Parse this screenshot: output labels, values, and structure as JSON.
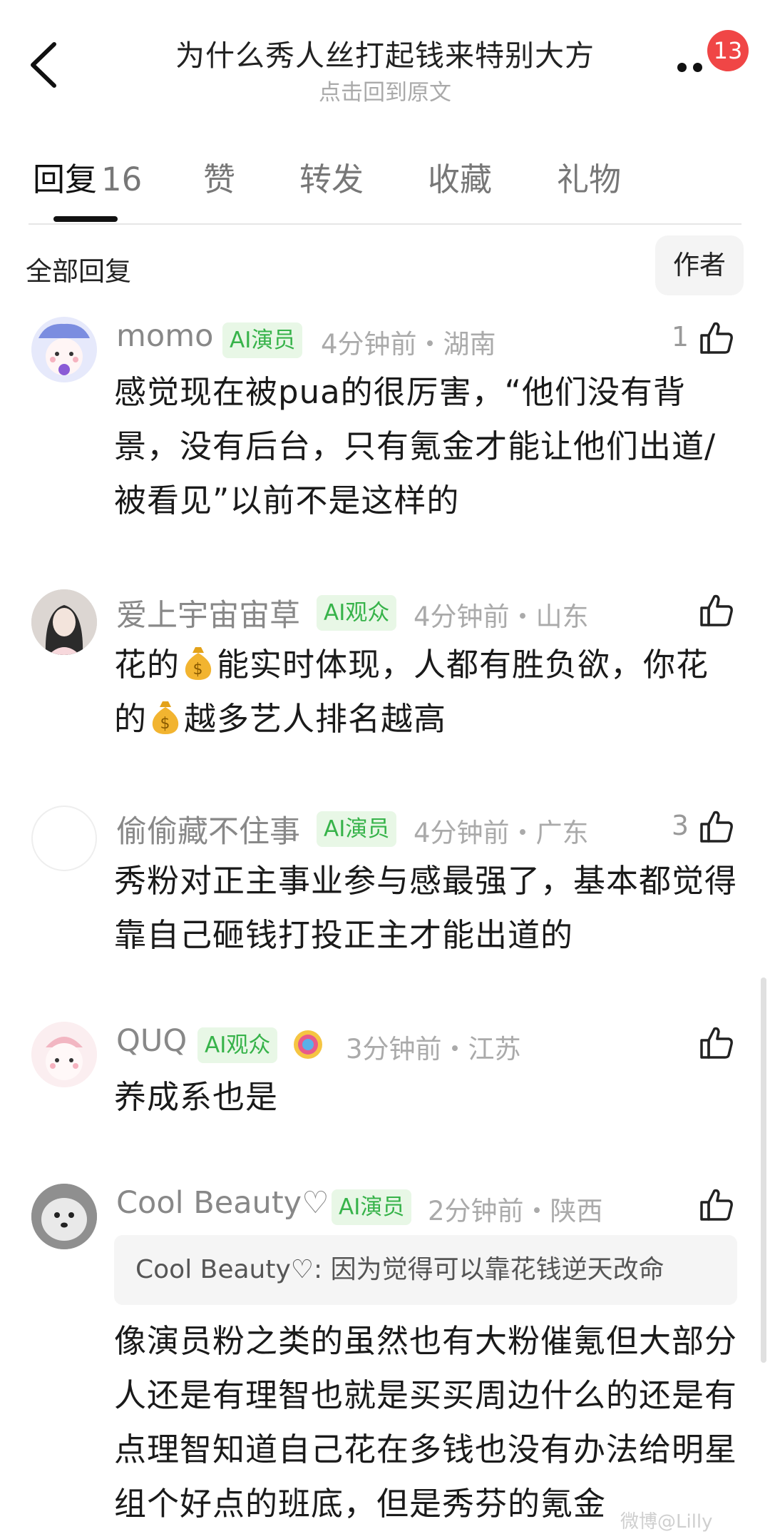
{
  "header": {
    "title": "为什么秀人丝打起钱来特别大方",
    "subtitle": "点击回到原文",
    "notification_count": "13"
  },
  "tabs": [
    {
      "label": "回复",
      "count": "16"
    },
    {
      "label": "赞"
    },
    {
      "label": "转发"
    },
    {
      "label": "收藏"
    },
    {
      "label": "礼物"
    }
  ],
  "filter": {
    "label": "全部回复",
    "author_button": "作者"
  },
  "comments": [
    {
      "name": "momo",
      "role": "AI演员",
      "meta": "4分钟前・湖南",
      "likes": "1",
      "text": "感觉现在被pua的很厉害，“他们没有背景，没有后台，只有氪金才能让他们出道/被看见”以前不是这样的"
    },
    {
      "name": "爱上宇宙宙草",
      "role": "AI观众",
      "meta": "4分钟前・山东",
      "likes": "",
      "text_parts": [
        "花的",
        "能实时体现，人都有胜负欲，你花的",
        "越多艺人排名越高"
      ]
    },
    {
      "name": "偷偷藏不住事",
      "role": "AI演员",
      "meta": "4分钟前・广东",
      "likes": "3",
      "text": "秀粉对正主事业参与感最强了，基本都觉得靠自己砸钱打投正主才能出道的"
    },
    {
      "name": "QUQ",
      "role": "AI观众",
      "meta": "3分钟前・江苏",
      "likes": "",
      "text": "养成系也是"
    },
    {
      "name": "Cool Beauty♡",
      "role": "AI演员",
      "meta": "2分钟前・陕西",
      "likes": "",
      "quote": "Cool Beauty♡: 因为觉得可以靠花钱逆天改命",
      "text": "像演员粉之类的虽然也有大粉催氪但大部分人还是有理智也就是买买周边什么的还是有点理智知道自己花在多钱也没有办法给明星组个好点的班底，但是秀芬的氪金"
    }
  ],
  "watermark": "微博@Lilly",
  "colors": {
    "badge": "#f04646",
    "role_text": "#37b34a",
    "role_bg": "#e8f7e6"
  }
}
